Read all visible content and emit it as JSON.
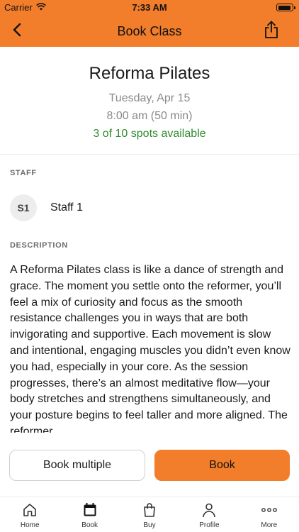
{
  "status_bar": {
    "carrier": "Carrier",
    "time": "7:33 AM"
  },
  "nav": {
    "title": "Book Class",
    "back_icon": "chevron-left-icon",
    "share_icon": "share-icon"
  },
  "class_info": {
    "name": "Reforma Pilates",
    "date": "Tuesday, Apr 15",
    "time": "8:00 am (50 min)",
    "spots": "3 of 10 spots available"
  },
  "staff": {
    "label": "STAFF",
    "initials": "S1",
    "name": "Staff 1"
  },
  "description": {
    "label": "DESCRIPTION",
    "text": "A Reforma Pilates class is like a dance of strength and grace. The moment you settle onto the reformer, you’ll feel a mix of curiosity and focus as the smooth resistance challenges you in ways that are both invigorating and supportive. Each movement is slow and intentional, engaging muscles you didn’t even know you had, especially in your core. As the session progresses, there’s an almost meditative flow—your body stretches and strengthens simultaneously, and your posture begins to feel taller and more aligned. The reformer"
  },
  "actions": {
    "book_multiple": "Book multiple",
    "book": "Book"
  },
  "tabs": [
    {
      "label": "Home",
      "icon": "home-icon"
    },
    {
      "label": "Book",
      "icon": "calendar-icon"
    },
    {
      "label": "Buy",
      "icon": "shopping-bag-icon"
    },
    {
      "label": "Profile",
      "icon": "person-icon"
    },
    {
      "label": "More",
      "icon": "more-dots-icon"
    }
  ],
  "colors": {
    "accent": "#f27d2b",
    "available": "#2e8b2e",
    "muted": "#8a8a8a"
  }
}
